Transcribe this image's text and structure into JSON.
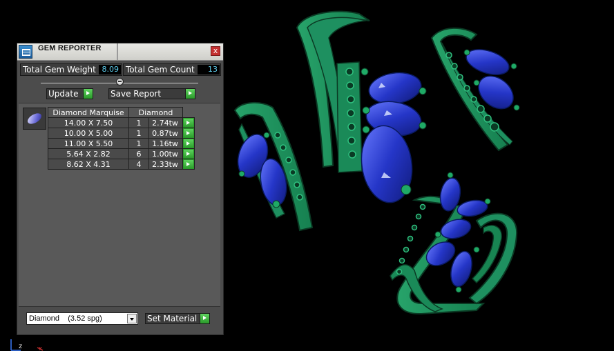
{
  "panel": {
    "title": "GEM REPORTER",
    "close_glyph": "x",
    "total_weight_label": "Total Gem Weight",
    "total_weight_value": "8.09",
    "total_count_label": "Total Gem Count",
    "total_count_value": "13",
    "update_label": "Update",
    "save_report_label": "Save Report",
    "slider_position": 0.5,
    "table": {
      "headers": [
        "Diamond Marquise",
        "Diamond"
      ],
      "rows": [
        {
          "size": "14.00 X 7.50",
          "count": "1",
          "weight": "2.74tw"
        },
        {
          "size": "10.00 X 5.00",
          "count": "1",
          "weight": "0.87tw"
        },
        {
          "size": "11.00 X 5.50",
          "count": "1",
          "weight": "1.16tw"
        },
        {
          "size": "5.64 X 2.82",
          "count": "6",
          "weight": "1.00tw"
        },
        {
          "size": "8.62 X 4.31",
          "count": "4",
          "weight": "2.33tw"
        }
      ]
    },
    "material_select_value": "Diamond    (3.52 spg)",
    "set_material_label": "Set Material"
  },
  "viewport": {
    "axis_labels": [
      "z",
      "x"
    ],
    "colors": {
      "background": "#000000",
      "metal": "#1f8a5a",
      "metal_edge": "#0d3d27",
      "gem": "#2a3fd6",
      "gem_highlight": "#8aa0ff"
    }
  },
  "icons": [
    "gem-reporter-app-icon",
    "close-icon",
    "slider-thumb-icon",
    "go-arrow-icon",
    "marquise-gem-icon",
    "dropdown-arrow-icon",
    "axis-gizmo-icon"
  ]
}
